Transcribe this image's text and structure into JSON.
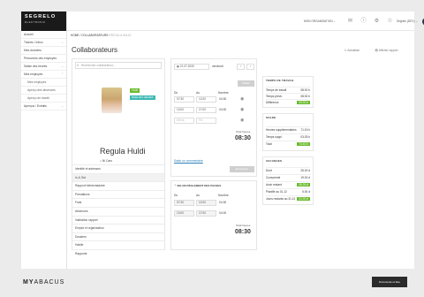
{
  "brand": {
    "name": "SEGRELO",
    "tagline": "ELEKTRONIK"
  },
  "sidebar": {
    "items": [
      {
        "label": "Accueil"
      },
      {
        "label": "Tâches / Inbox"
      },
      {
        "label": "Mes données"
      },
      {
        "label": "Personnes des employés"
      },
      {
        "label": "Saisie des heures"
      },
      {
        "label": "Mes employés"
      },
      {
        "label": "Mes employés"
      },
      {
        "label": "Aperçu des absences"
      },
      {
        "label": "Aperçu de travail"
      },
      {
        "label": "Aperçus / Extraits"
      }
    ]
  },
  "topbar": {
    "org": "MON ORGANISATION",
    "user": "Segrelo (DEV)",
    "avatar_initials": "RH"
  },
  "breadcrumb": {
    "home": "HOME",
    "section": "COLLABORATEURS",
    "current": "REGULA HULDI"
  },
  "page": {
    "title": "Collaborateurs",
    "refresh_label": "Actualiser",
    "report_label": "Afficher rapport"
  },
  "person": {
    "search_placeholder": "Rechercher collaborateur...",
    "badge1": "TEAM",
    "badge2": "BASE DES HEURES",
    "name": "Regula Huldi",
    "status": "Ni Caro",
    "menu": [
      "Identité et adresses",
      "In & Out",
      "Rapport hebdomadaire",
      "Prestations",
      "Frais",
      "Absences",
      "Validation rapport",
      "Emploi et organisation",
      "Dossiers",
      "Habile",
      "Rapports"
    ]
  },
  "timecard": {
    "date": "21.07.2020",
    "weekday": "vendredi",
    "button": "Valider",
    "col_from": "Du",
    "col_to": "Au",
    "col_count": "Nombre",
    "rows": [
      {
        "from": "07:30",
        "to": "12:00",
        "count": "04:30"
      },
      {
        "from": "13:00",
        "to": "17:00",
        "count": "04:00"
      }
    ],
    "placeholder_from": "Début",
    "placeholder_to": "Fin",
    "total_label": "Total heures",
    "total": "08:30",
    "comment_link": "Saisir un commentaire",
    "save_button": "Enregistrer"
  },
  "schedule": {
    "title": "SELON RÈGLEMENT DES PAUSES",
    "col_from": "Du",
    "col_to": "Au",
    "col_count": "Nombre",
    "rows": [
      {
        "from": "07:30",
        "to": "12:00",
        "count": "04:30"
      },
      {
        "from": "13:00",
        "to": "17:00",
        "count": "04:00"
      }
    ],
    "total_label": "Total heures",
    "total": "08:30"
  },
  "stats": {
    "work": {
      "title": "TEMPS DE TRAVAIL",
      "rows": [
        {
          "label": "Temps de travail",
          "value": "08:30 h"
        },
        {
          "label": "Temps prévu",
          "value": "08:30 h"
        },
        {
          "label": "Différence",
          "value": "00:00 h",
          "green": true
        }
      ]
    },
    "balance": {
      "title": "SOLDE",
      "rows": [
        {
          "label": "Heures supplémentaires",
          "value": "71:15 h"
        },
        {
          "label": "Temps suppl.",
          "value": "03:25 h"
        },
        {
          "label": "Total",
          "value": "74:40 h",
          "green": true
        }
      ]
    },
    "vacation": {
      "title": "VACANCES",
      "rows": [
        {
          "label": "Droit",
          "value": "25.00 d"
        },
        {
          "label": "Consommé",
          "value": "19.00 d"
        },
        {
          "label": "Avoir restant",
          "value": "06.00 d",
          "green": true
        },
        {
          "label": "Planifié au 31.12",
          "value": "5.00 d"
        },
        {
          "label": "Jours restants au 31.12",
          "value": "01.00 d",
          "green": true
        }
      ]
    }
  },
  "footer": {
    "logo_a": "MY",
    "logo_b": "ABACUS",
    "doc_button": "Documents et liste"
  },
  "colors": {
    "accent_green": "#6bbb2d",
    "teal_badge": "#3cb8b3",
    "dark": "#1a1a1a",
    "link": "#2a7fb8"
  }
}
